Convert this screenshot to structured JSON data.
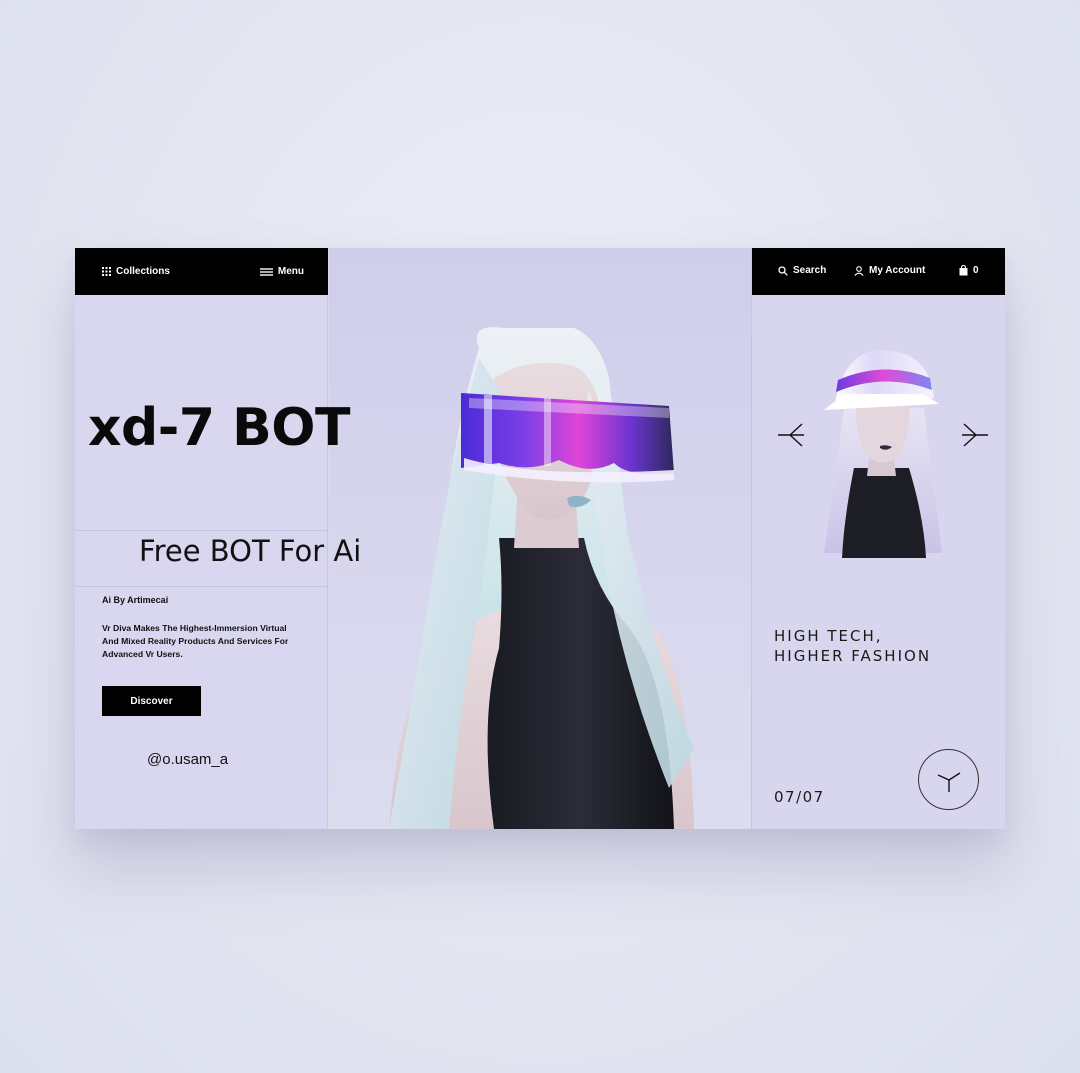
{
  "nav": {
    "collections_label": "Collections",
    "menu_label": "Menu",
    "search_label": "Search",
    "account_label": "My Account",
    "cart_count": "0"
  },
  "hero": {
    "title": "xd-7 BOT",
    "subtitle": "Free BOT For Ai"
  },
  "intro": {
    "ai_by": "Ai By Artimecai",
    "description_line1": "Vr Diva Makes The Highest-Immersion Virtual",
    "description_line2": "And Mixed Reality Products And Services For",
    "description_line3": "Advanced Vr Users.",
    "cta_label": "Discover",
    "handle": "@o.usam_a"
  },
  "side": {
    "tagline_line1": "HIGH TECH,",
    "tagline_line2": "HIGHER FASHION",
    "counter": "07/07"
  },
  "colors": {
    "bar_bg": "#000000",
    "panel_bg": "#d8d7ef",
    "page_bg": "#e4e6f2",
    "visor_accent": "#b23bd8"
  }
}
